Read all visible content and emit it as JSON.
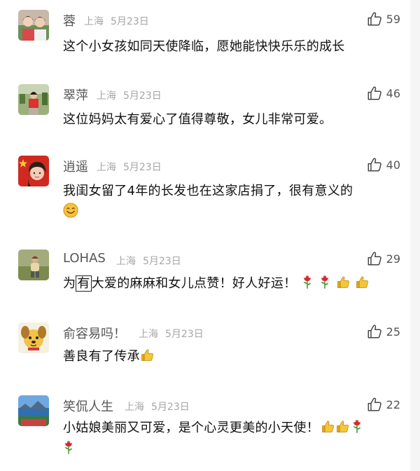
{
  "comments": [
    {
      "name": "蓉",
      "location": "上海",
      "date": "5月23日",
      "likes": "59",
      "text": "这个小女孩如同天使降临，愿她能快快乐乐的成长",
      "avatar": "avatar-two-girls"
    },
    {
      "name": "翠萍",
      "location": "上海",
      "date": "5月23日",
      "likes": "46",
      "text": "这位妈妈太有爱心了值得尊敬，女儿非常可爱。",
      "avatar": "avatar-person-garden"
    },
    {
      "name": "逍遥",
      "location": "上海",
      "date": "5月23日",
      "likes": "40",
      "text": "我闺女留了4年的长发也在这家店捐了，很有意义的",
      "emojis": [
        "smile"
      ],
      "avatar": "avatar-girl-flag"
    },
    {
      "name": "LOHAS",
      "location": "上海",
      "date": "5月23日",
      "likes": "29",
      "text_boxed_char": "为",
      "text_boxed": "有",
      "text": "大爱的麻麻和女儿点赞！好人好运！",
      "emojis": [
        "rose",
        "rose",
        "thumbs-up",
        "thumbs-up"
      ],
      "avatar": "avatar-child-field"
    },
    {
      "name": "俞容易吗！",
      "location": "上海",
      "date": "5月23日",
      "likes": "25",
      "text": "善良有了传承",
      "emojis": [
        "thumbs-up"
      ],
      "avatar": "avatar-cartoon-dog"
    },
    {
      "name": "笑侃人生",
      "location": "上海",
      "date": "5月23日",
      "likes": "22",
      "text": "小姑娘美丽又可爱，是个心灵更美的小天使！",
      "emojis": [
        "thumbs-up",
        "thumbs-up",
        "rose",
        "rose"
      ],
      "avatar": "avatar-coast-landscape"
    }
  ]
}
